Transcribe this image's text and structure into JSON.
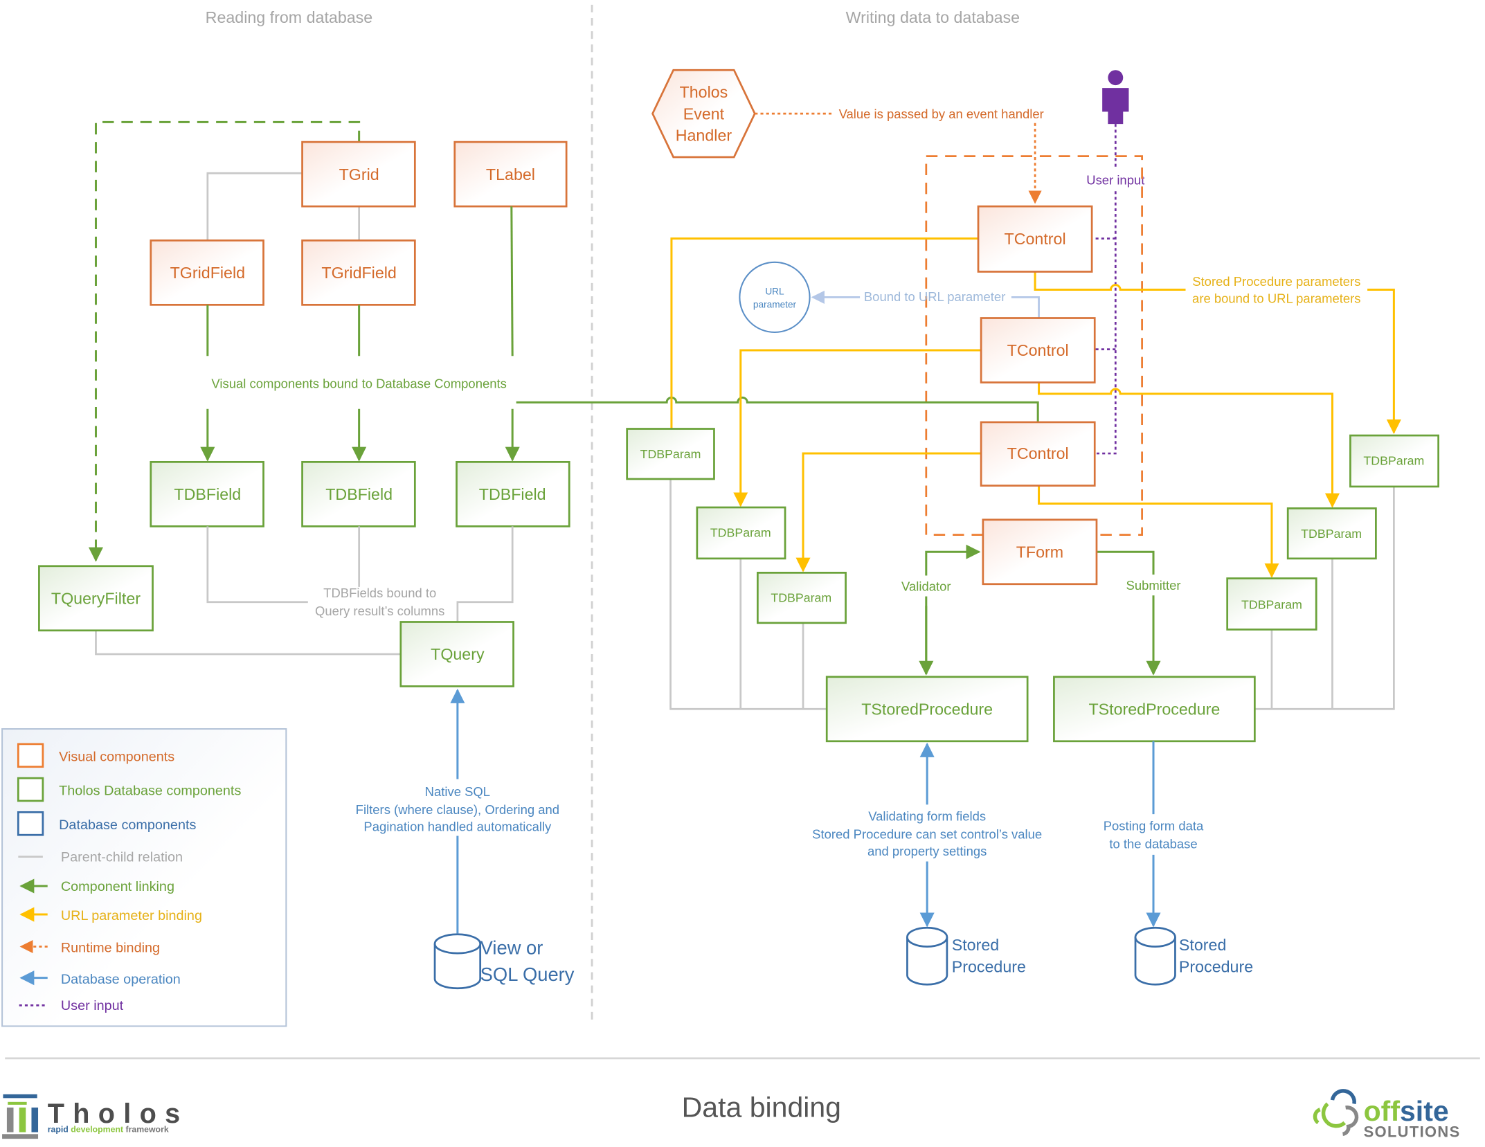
{
  "sections": {
    "reading": "Reading from database",
    "writing": "Writing data to database"
  },
  "left": {
    "tgrid": "TGrid",
    "tlabel": "TLabel",
    "tgridfield_1": "TGridField",
    "tgridfield_2": "TGridField",
    "tdbfield_1": "TDBField",
    "tdbfield_2": "TDBField",
    "tdbfield_3": "TDBField",
    "tqueryfilter": "TQueryFilter",
    "tquery": "TQuery",
    "bound_label": "Visual components bound to Database Components",
    "tdbfields_bound_line1": "TDBFields bound to",
    "tdbfields_bound_line2": "Query result’s columns",
    "native_sql_line1": "Native SQL",
    "native_sql_line2": "Filters (where clause), Ordering and",
    "native_sql_line3": "Pagination handled automatically",
    "db_view_line1": "View or",
    "db_view_line2": "SQL Query"
  },
  "right": {
    "event_handler_line1": "Tholos",
    "event_handler_line2": "Event",
    "event_handler_line3": "Handler",
    "event_handler_label": "Value is passed by an event handler",
    "user_input_label": "User input",
    "url_param_line1": "URL",
    "url_param_line2": "parameter",
    "bound_url_label": "Bound to URL parameter",
    "sp_params_line1": "Stored Procedure parameters",
    "sp_params_line2": "are bound to URL parameters",
    "tcontrol_1": "TControl",
    "tcontrol_2": "TControl",
    "tcontrol_3": "TControl",
    "tform": "TForm",
    "validator": "Validator",
    "submitter": "Submitter",
    "tdbparams": [
      "TDBParam",
      "TDBParam",
      "TDBParam",
      "TDBParam",
      "TDBParam",
      "TDBParam"
    ],
    "tstoredprocedure_1": "TStoredProcedure",
    "tstoredprocedure_2": "TStoredProcedure",
    "validating_line1": "Validating form fields",
    "validating_line2": "Stored Procedure can set control’s value",
    "validating_line3": "and property settings",
    "posting_line1": "Posting form data",
    "posting_line2": "to the database",
    "db_sp1_line1": "Stored",
    "db_sp1_line2": "Procedure",
    "db_sp2_line1": "Stored",
    "db_sp2_line2": "Procedure"
  },
  "legend": {
    "items": [
      {
        "label": "Visual components",
        "icon": "orange-square"
      },
      {
        "label": "Tholos Database components",
        "icon": "green-square"
      },
      {
        "label": "Database components",
        "icon": "blue-square"
      },
      {
        "label": "Parent-child relation",
        "icon": "gray-line"
      },
      {
        "label": "Component linking",
        "icon": "green-arrow"
      },
      {
        "label": "URL parameter binding",
        "icon": "yellow-arrow"
      },
      {
        "label": "Runtime binding",
        "icon": "orange-dotted-arrow"
      },
      {
        "label": "Database operation",
        "icon": "blue-arrow"
      },
      {
        "label": "User input",
        "icon": "purple-dotted-line"
      }
    ]
  },
  "footer": {
    "title": "Data binding",
    "tholos_logo_word": "Tholos",
    "tholos_tag_1": "rapid",
    "tholos_tag_2": "development",
    "tholos_tag_3": "framework",
    "offsite_off": "off",
    "offsite_site": "site",
    "offsite_solutions": "SOLUTIONS"
  },
  "colors": {
    "visual": "#ed7d31",
    "database_tholos": "#70ad47",
    "database": "#4a86c0",
    "parent_child": "#c8c8c8",
    "url_binding": "#ffc000",
    "user_input": "#7030a0"
  }
}
